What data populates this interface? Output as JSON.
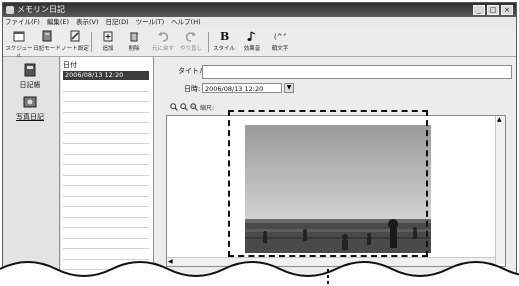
{
  "window": {
    "title": "メモリン日記",
    "controls": {
      "minimize": "_",
      "maximize": "□",
      "close": "×"
    }
  },
  "menu": [
    "ファイル(F)",
    "編集(E)",
    "表示(V)",
    "日記(D)",
    "ツール(T)",
    "ヘルプ(H)"
  ],
  "toolbar": {
    "buttons": [
      {
        "label": "スケジュール",
        "icon": "calendar-icon"
      },
      {
        "label": "日記モード",
        "icon": "diary-icon"
      },
      {
        "label": "ノート設定",
        "icon": "note-icon"
      },
      {
        "label": "追加",
        "icon": "add-icon"
      },
      {
        "label": "削除",
        "icon": "delete-icon"
      },
      {
        "label": "元に戻す",
        "icon": "undo-icon"
      },
      {
        "label": "やり直し",
        "icon": "redo-icon"
      },
      {
        "label": "スタイル",
        "icon": "bold-icon"
      },
      {
        "label": "効果音",
        "icon": "music-icon"
      },
      {
        "label": "顔文字",
        "icon": "emoticon-icon"
      }
    ]
  },
  "sidebar": {
    "items": [
      {
        "label": "日記帳",
        "icon": "notebook-icon"
      },
      {
        "label": "写真日記",
        "icon": "photo-diary-icon"
      }
    ]
  },
  "list": {
    "header": "日付",
    "selected": "2006/08/13 12:20"
  },
  "editor": {
    "title_label": "タイトル:",
    "title_value": "",
    "date_label": "日時:",
    "date_value": "2006/08/13 12:20",
    "zoom_label": "縮尺:"
  },
  "colors": {
    "titlebar": "#3a3a3a",
    "selection": "#3c3c3c",
    "panel": "#e6e6e6"
  }
}
